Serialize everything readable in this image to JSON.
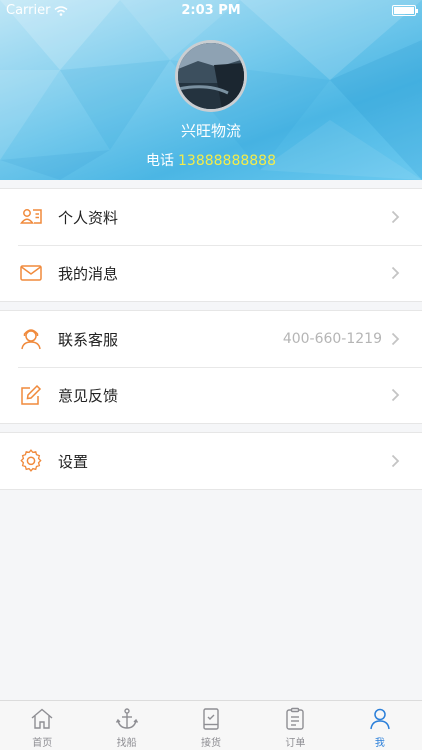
{
  "status_bar": {
    "carrier": "Carrier",
    "time": "2:03 PM"
  },
  "profile": {
    "name": "兴旺物流",
    "phone_label": "电话",
    "phone_number": "13888888888"
  },
  "menu_groups": [
    {
      "items": [
        {
          "label": "个人资料",
          "icon": "profile-card-icon"
        },
        {
          "label": "我的消息",
          "icon": "envelope-icon"
        }
      ]
    },
    {
      "items": [
        {
          "label": "联系客服",
          "value": "400-660-1219",
          "icon": "customer-service-icon"
        },
        {
          "label": "意见反馈",
          "icon": "edit-feedback-icon"
        }
      ]
    },
    {
      "items": [
        {
          "label": "设置",
          "icon": "gear-icon"
        }
      ]
    }
  ],
  "tabs": [
    {
      "label": "首页",
      "icon": "home-icon"
    },
    {
      "label": "找船",
      "icon": "anchor-icon"
    },
    {
      "label": "接货",
      "icon": "package-check-icon"
    },
    {
      "label": "订单",
      "icon": "order-list-icon"
    },
    {
      "label": "我",
      "icon": "person-icon",
      "active": true
    }
  ],
  "colors": {
    "accent_orange": "#f08a3c",
    "phone_yellow": "#f4ec4a",
    "tab_active": "#2b7fd9"
  }
}
